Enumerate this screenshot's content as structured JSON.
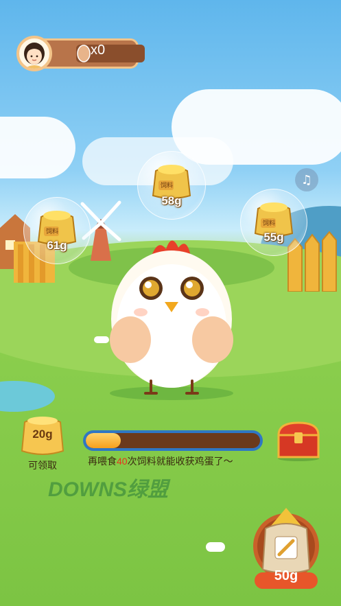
{
  "profile": {
    "egg_count": "x0"
  },
  "bubbles": [
    {
      "sack_label": "饲料",
      "amount": "58g"
    },
    {
      "sack_label": "饲料",
      "amount": "61g"
    },
    {
      "sack_label": "饲料",
      "amount": "55g"
    }
  ],
  "music_icon": "music-note-icon",
  "claim": {
    "amount": "20g",
    "label": "可领取"
  },
  "progress": {
    "fraction": 0.2,
    "text_prefix": "再喂食",
    "count": "40",
    "text_suffix": "次饲料就能收获鸡蛋了～"
  },
  "watermark": {
    "text": "DOWNS绿盟"
  },
  "feed": {
    "amount": "50g"
  },
  "colors": {
    "accent": "#f59f1d",
    "track": "#2f77c4",
    "count_highlight": "#e8321e"
  }
}
